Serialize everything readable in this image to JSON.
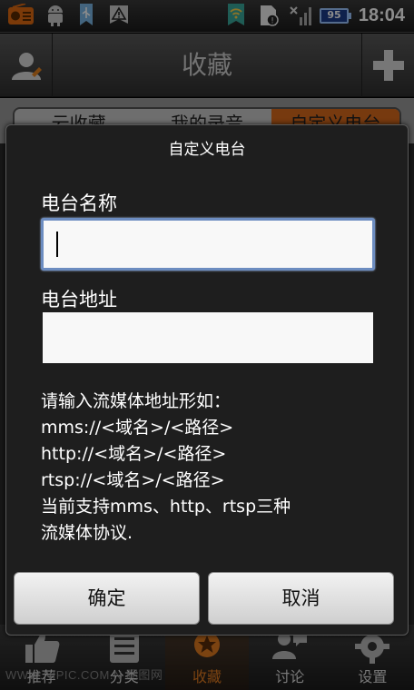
{
  "status_bar": {
    "icons": [
      "radio-icon",
      "android-debug-icon",
      "usb-icon",
      "warning-icon",
      "wifi-hotspot-icon",
      "sim-card-icon",
      "signal-icon"
    ],
    "battery": "95",
    "time": "18:04"
  },
  "title_bar": {
    "title": "收藏",
    "left_icon": "user-icon",
    "right_icon": "plus-icon"
  },
  "tabs": [
    {
      "label": "云收藏"
    },
    {
      "label": "我的录音"
    },
    {
      "label": "自定义电台",
      "active": true
    }
  ],
  "dialog": {
    "title": "自定义电台",
    "name_label": "电台名称",
    "name_value": "",
    "address_label": "电台地址",
    "address_value": "",
    "hint_lines": [
      "请输入流媒体地址形如：",
      "mms://<域名>/<路径>",
      "http://<域名>/<路径>",
      "rtsp://<域名>/<路径>",
      "当前支持mms、http、rtsp三种",
      "流媒体协议."
    ],
    "ok_label": "确定",
    "cancel_label": "取消"
  },
  "bottom_nav": [
    {
      "label": "推荐",
      "icon": "thumbs-up-icon"
    },
    {
      "label": "分类",
      "icon": "list-icon"
    },
    {
      "label": "收藏",
      "icon": "favorite-icon",
      "active": true
    },
    {
      "label": "讨论",
      "icon": "chat-icon"
    },
    {
      "label": "设置",
      "icon": "gear-icon"
    }
  ],
  "watermark": "WWW.NIPIC.COM.N 昵图网",
  "colors": {
    "accent": "#d96a1c",
    "input_focus": "#6c8cc0",
    "battery": "#1c3c8a"
  }
}
